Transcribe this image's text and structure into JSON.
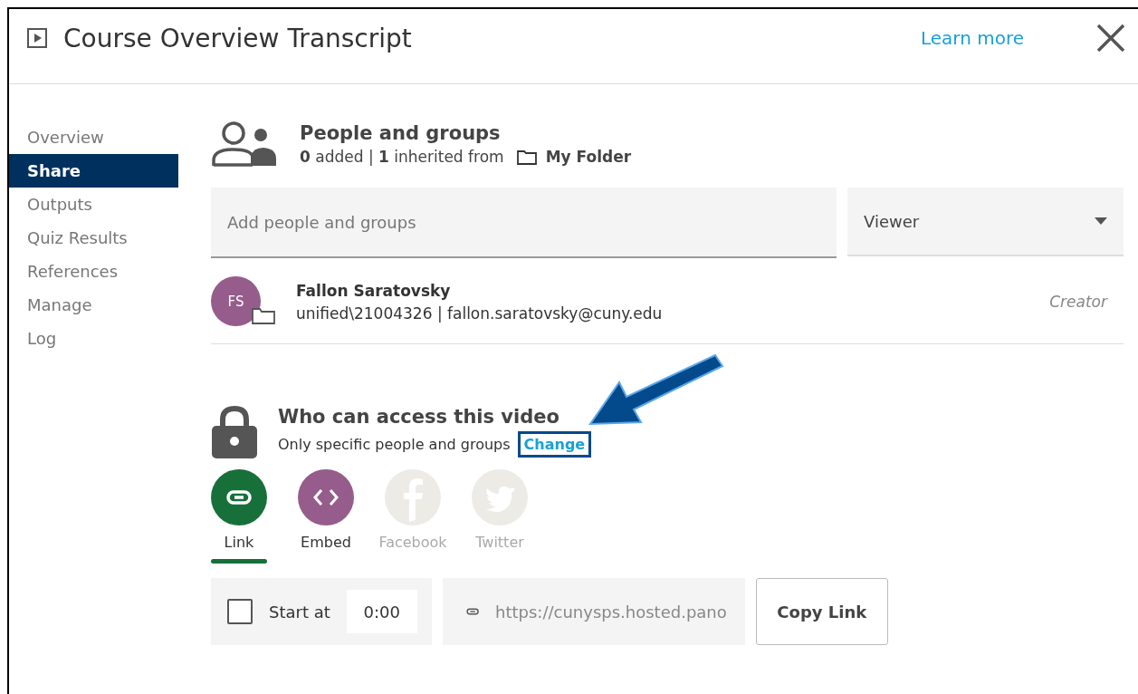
{
  "window": {
    "title": "Course Overview Transcript",
    "help_link": "Learn more"
  },
  "sidebar": {
    "items": [
      {
        "label": "Overview",
        "selected": false
      },
      {
        "label": "Share",
        "selected": true
      },
      {
        "label": "Outputs",
        "selected": false
      },
      {
        "label": "Quiz Results",
        "selected": false
      },
      {
        "label": "References",
        "selected": false
      },
      {
        "label": "Manage",
        "selected": false
      },
      {
        "label": "Log",
        "selected": false
      }
    ]
  },
  "people": {
    "title": "People and groups",
    "summary": "**0** added | **1** inherited from",
    "folder": "My Folder",
    "add_placeholder": "Add people and groups",
    "role": "Viewer",
    "members": [
      {
        "initials": "FS",
        "name": "Fallon Saratovsky",
        "detail": "unified\\21004326 | fallon.saratovsky@cuny.edu",
        "role": "Creator",
        "color": "#955c8c"
      }
    ]
  },
  "access": {
    "title": "Who can access this video",
    "description": "Only specific people and groups",
    "change_link": "Change",
    "change_highlighted": true
  },
  "share_options": [
    {
      "kind": "link",
      "label": "Link",
      "selected": true,
      "disabled": false,
      "color": "#17703a"
    },
    {
      "kind": "embed",
      "label": "Embed",
      "selected": false,
      "disabled": false,
      "color": "#955c8c"
    },
    {
      "kind": "facebook",
      "label": "Facebook",
      "selected": false,
      "disabled": true,
      "color": "#ecebe6"
    },
    {
      "kind": "twitter",
      "label": "Twitter",
      "selected": false,
      "disabled": true,
      "color": "#ecebe6"
    }
  ],
  "link_bar": {
    "start_at_label": "Start at",
    "start_at_checked": false,
    "start_time": "0:00",
    "url": "https://cunysps.hosted.pano",
    "copy_button": "Copy Link"
  }
}
